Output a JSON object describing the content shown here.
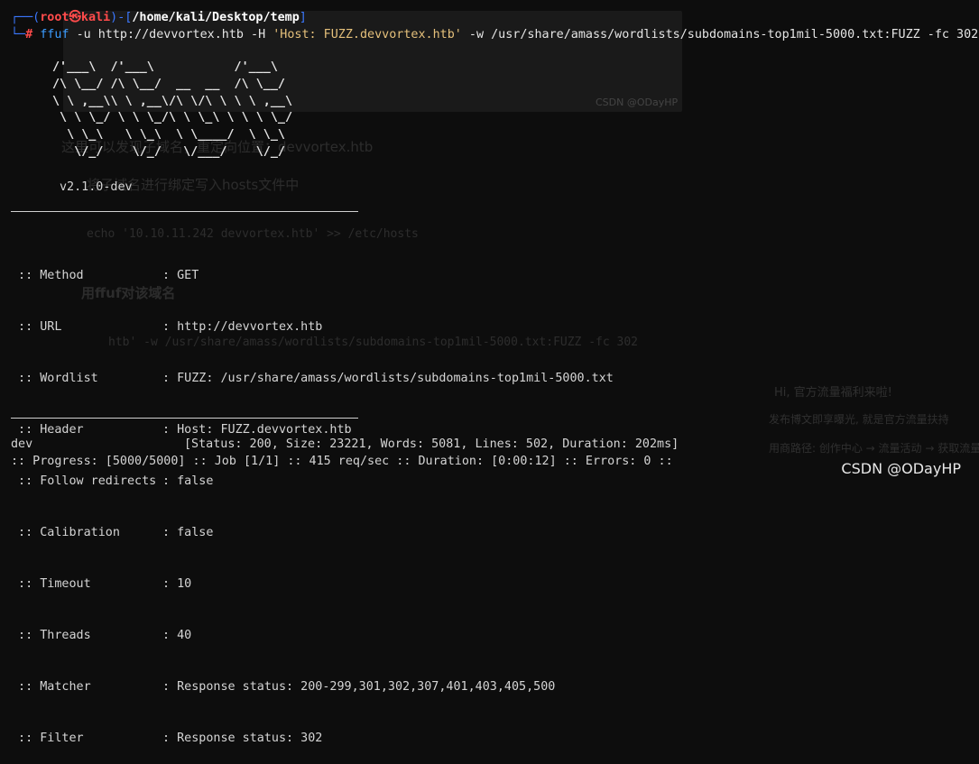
{
  "prompt": {
    "user": "root",
    "at_symbol": "㉿",
    "host": "kali",
    "cwd": "/home/kali/Desktop/temp",
    "symbol": "#",
    "command": "ffuf",
    "args": "-u http://devvortex.htb -H ",
    "header_string": "'Host: FUZZ.devvortex.htb'",
    "rest": " -w /usr/share/amass/wordlists/subdomains-top1mil-5000.txt:FUZZ -fc 302"
  },
  "banner": {
    "art": "/'___\\  /'___\\           /'___\\\n/\\ \\__/ /\\ \\__/  __  __  /\\ \\__/\n\\ \\ ,__\\\\ \\ ,__\\/\\ \\/\\ \\ \\ \\ ,__\\\n \\ \\ \\_/ \\ \\ \\_/\\ \\ \\_\\ \\ \\ \\ \\_/\n  \\ \\_\\   \\ \\_\\  \\ \\____/  \\ \\_\\\n   \\/_/    \\/_/   \\/___/    \\/_/",
    "version": "v2.1.0-dev"
  },
  "config": [
    {
      "key": " :: Method",
      "value": ": GET"
    },
    {
      "key": " :: URL",
      "value": ": http://devvortex.htb"
    },
    {
      "key": " :: Wordlist",
      "value": ": FUZZ: /usr/share/amass/wordlists/subdomains-top1mil-5000.txt"
    },
    {
      "key": " :: Header",
      "value": ": Host: FUZZ.devvortex.htb"
    },
    {
      "key": " :: Follow redirects",
      "value": ": false"
    },
    {
      "key": " :: Calibration",
      "value": ": false"
    },
    {
      "key": " :: Timeout",
      "value": ": 10"
    },
    {
      "key": " :: Threads",
      "value": ": 40"
    },
    {
      "key": " :: Matcher",
      "value": ": Response status: 200-299,301,302,307,401,403,405,500"
    },
    {
      "key": " :: Filter",
      "value": ": Response status: 302"
    }
  ],
  "result": {
    "name": "dev",
    "details": "[Status: 200, Size: 23221, Words: 5081, Lines: 502, Duration: 202ms]"
  },
  "progress": ":: Progress: [5000/5000] :: Job [1/1] :: 415 req/sec :: Duration: [0:00:12] :: Errors: 0 ::",
  "watermark": "CSDN @ODayHP",
  "ghost_text": {
    "line1": "这里可以发现子域名，重定向位置：devvortex.htb",
    "line2": "将子域名进行绑定写入hosts文件中",
    "line3": "echo '10.10.11.242 devvortex.htb' >> /etc/hosts",
    "line4": "用ffuf对该域名",
    "line5": "htb' -w /usr/share/amass/wordlists/subdomains-top1mil-5000.txt:FUZZ -fc 302",
    "caption": "CSDN @ODayHP",
    "side1": "Hi, 官方流量福利来啦!",
    "side2": "发布博文即享曝光, 就是官方流量扶持",
    "side3": "用商路径: 创作中心 → 流量活动 → 获取流量"
  }
}
